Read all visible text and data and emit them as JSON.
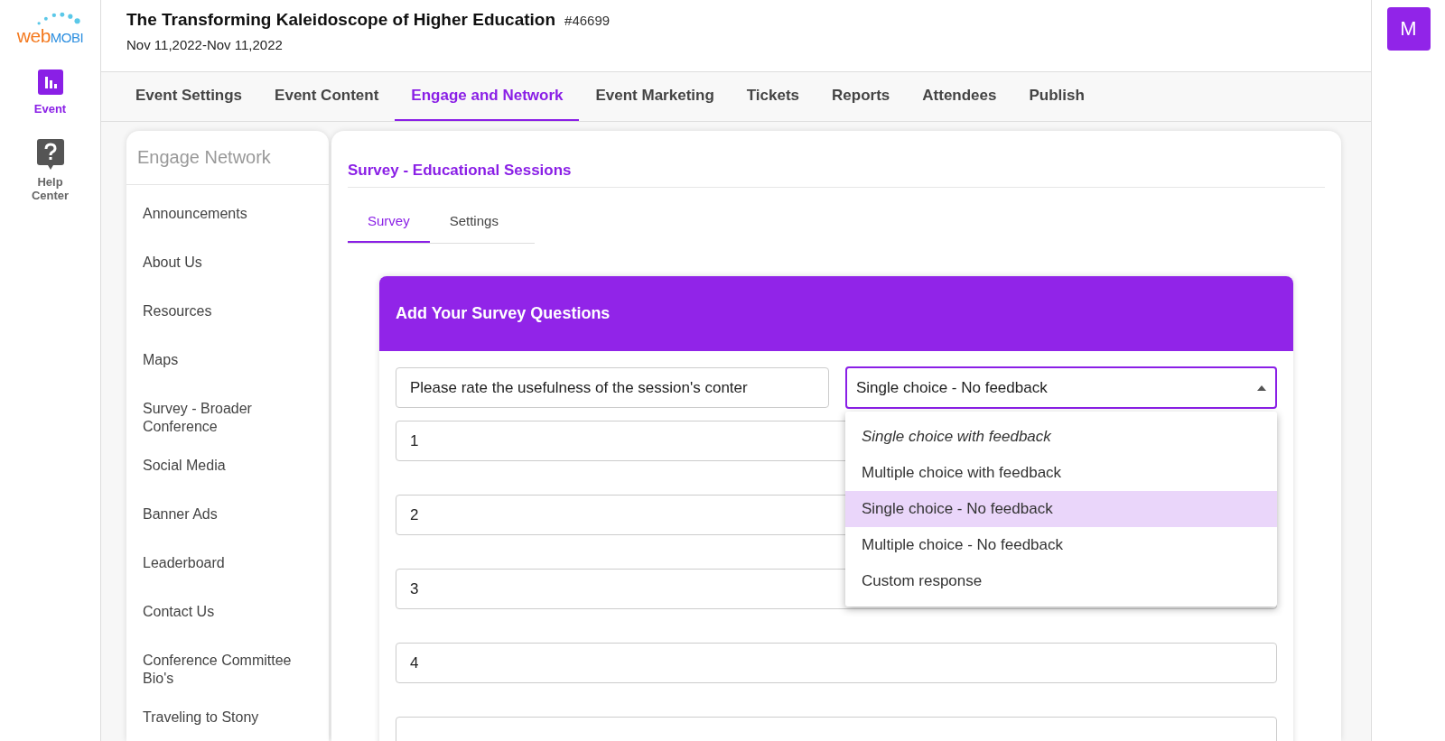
{
  "logo": {
    "part_1": "web",
    "part_2": "MOBI"
  },
  "nav": [
    {
      "kind": "chart",
      "label": "Event",
      "selected": true
    },
    {
      "kind": "help",
      "label": "Help Center",
      "selected": false
    }
  ],
  "event": {
    "title": "The Transforming Kaleidoscope of Higher Education",
    "id": "#46699",
    "dates": "Nov 11,2022-Nov 11,2022"
  },
  "avatar": "M",
  "tabs": [
    {
      "label": "Event Settings",
      "selected": false
    },
    {
      "label": "Event Content",
      "selected": false
    },
    {
      "label": "Engage and Network",
      "selected": true
    },
    {
      "label": "Event Marketing",
      "selected": false
    },
    {
      "label": "Tickets",
      "selected": false
    },
    {
      "label": "Reports",
      "selected": false
    },
    {
      "label": "Attendees",
      "selected": false
    },
    {
      "label": "Publish",
      "selected": false
    }
  ],
  "side_panel": {
    "title": "Engage Network",
    "items": [
      "Announcements",
      "About Us",
      "Resources",
      "Maps",
      "Survey - Broader Conference",
      "Social Media",
      "Banner Ads",
      "Leaderboard",
      "Contact Us",
      "Conference Committee Bio's",
      "Traveling to Stony"
    ]
  },
  "survey": {
    "title": "Survey - Educational Sessions",
    "tabs": [
      {
        "label": "Survey",
        "selected": true
      },
      {
        "label": "Settings",
        "selected": false
      }
    ],
    "card_title": "Add Your Survey Questions",
    "question": "Please rate the usefulness of the session's conter",
    "type_select": {
      "value": "Single choice - No feedback",
      "expanded": true,
      "options": [
        {
          "label": "Single choice with feedback",
          "selected": false,
          "italic": true
        },
        {
          "label": "Multiple choice with feedback",
          "selected": false,
          "italic": false
        },
        {
          "label": "Single choice - No feedback",
          "selected": true,
          "italic": false
        },
        {
          "label": "Multiple choice - No feedback",
          "selected": false,
          "italic": false
        },
        {
          "label": "Custom response",
          "selected": false,
          "italic": false
        }
      ]
    },
    "answers": [
      "1",
      "2",
      "3",
      "4"
    ]
  }
}
